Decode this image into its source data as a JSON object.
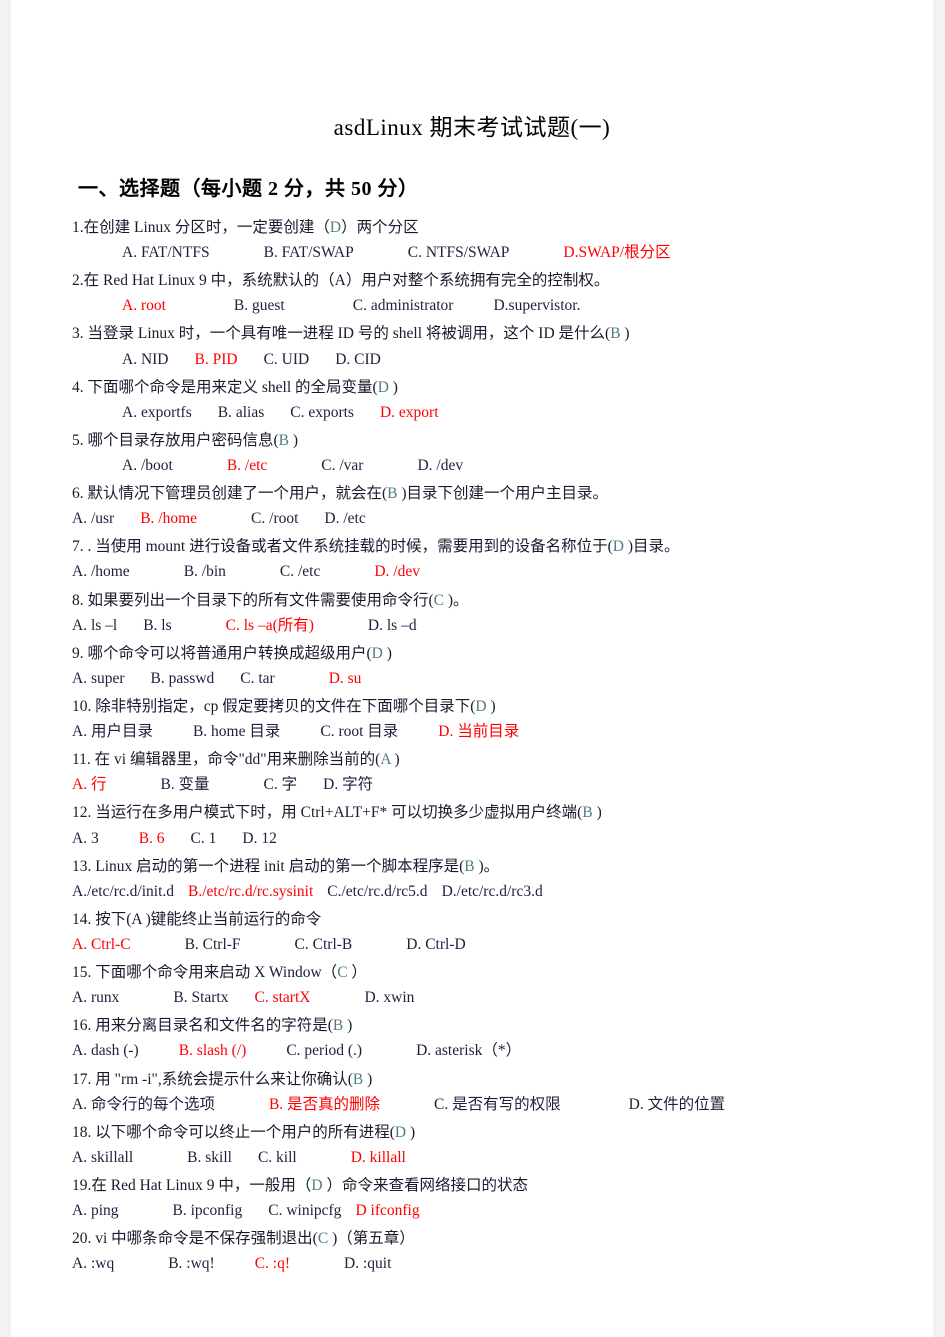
{
  "document": {
    "title": "asdLinux  期末考试试题(一)",
    "section_heading": "一、选择题（每小题 2 分，共 50 分）"
  },
  "questions": [
    {
      "stem_prefix": "1.在创建 Linux 分区时，一定要创建（",
      "answer": "D",
      "stem_suffix": "）两个分区",
      "answer_color": "teal",
      "options_indent": "indent",
      "options": [
        {
          "label": "A. FAT/NTFS",
          "correct": false,
          "gap": "sp-3"
        },
        {
          "label": "B. FAT/SWAP",
          "correct": false,
          "gap": "sp-3"
        },
        {
          "label": "C. NTFS/SWAP",
          "correct": false,
          "gap": "sp-3"
        },
        {
          "label": "D.SWAP/根分区",
          "correct": true,
          "gap": "sp-6"
        }
      ]
    },
    {
      "stem_prefix": "2.在 Red Hat Linux 9 中，系统默认的（",
      "answer": "A",
      "stem_suffix": "）用户对整个系统拥有完全的控制权。",
      "answer_color": "black",
      "options_indent": "indent",
      "options": [
        {
          "label": "A. root",
          "correct": true,
          "gap": "sp-5"
        },
        {
          "label": "B. guest",
          "correct": false,
          "gap": "sp-5"
        },
        {
          "label": "C. administrator",
          "correct": false,
          "gap": "sp-2"
        },
        {
          "label": "D.supervistor.",
          "correct": false,
          "gap": "sp-6"
        }
      ]
    },
    {
      "stem_prefix": "3. 当登录 Linux 时，一个具有唯一进程 ID 号的 shell 将被调用，这个 ID 是什么(",
      "answer": "B",
      "stem_suffix": "  )",
      "answer_color": "teal",
      "options_indent": "indent",
      "options": [
        {
          "label": "A. NID",
          "correct": false,
          "gap": "sp-1"
        },
        {
          "label": "B. PID",
          "correct": true,
          "gap": "sp-1"
        },
        {
          "label": "C. UID",
          "correct": false,
          "gap": "sp-1"
        },
        {
          "label": "D. CID",
          "correct": false,
          "gap": "sp-6"
        }
      ]
    },
    {
      "stem_prefix": "4. 下面哪个命令是用来定义 shell 的全局变量(",
      "answer": "D",
      "stem_suffix": "  )",
      "answer_color": "teal",
      "options_indent": "indent",
      "options": [
        {
          "label": "A. exportfs",
          "correct": false,
          "gap": "sp-1"
        },
        {
          "label": "B. alias",
          "correct": false,
          "gap": "sp-1"
        },
        {
          "label": "C. exports",
          "correct": false,
          "gap": "sp-1"
        },
        {
          "label": "D. export",
          "correct": true,
          "gap": "sp-6"
        }
      ]
    },
    {
      "stem_prefix": "5. 哪个目录存放用户密码信息(",
      "answer": "B",
      "stem_suffix": "  )",
      "answer_color": "teal",
      "options_indent": "indent",
      "options": [
        {
          "label": "A. /boot",
          "correct": false,
          "gap": "sp-3"
        },
        {
          "label": "B. /etc",
          "correct": true,
          "gap": "sp-3"
        },
        {
          "label": "C. /var",
          "correct": false,
          "gap": "sp-3"
        },
        {
          "label": "D. /dev",
          "correct": false,
          "gap": "sp-6"
        }
      ]
    },
    {
      "stem_prefix": "6. 默认情况下管理员创建了一个用户，就会在(",
      "answer": "B",
      "stem_suffix": "  )目录下创建一个用户主目录。",
      "answer_color": "teal",
      "options_indent": "flush",
      "options": [
        {
          "label": "A. /usr",
          "correct": false,
          "gap": "sp-1"
        },
        {
          "label": "B. /home",
          "correct": true,
          "gap": "sp-3"
        },
        {
          "label": "C. /root",
          "correct": false,
          "gap": "sp-1"
        },
        {
          "label": "D. /etc",
          "correct": false,
          "gap": "sp-6"
        }
      ]
    },
    {
      "stem_prefix": "7. . 当使用 mount 进行设备或者文件系统挂载的时候，需要用到的设备名称位于(",
      "answer": "D",
      "stem_suffix": " )目录。",
      "answer_color": "teal",
      "options_indent": "flush",
      "options": [
        {
          "label": "A. /home",
          "correct": false,
          "gap": "sp-3"
        },
        {
          "label": "B. /bin",
          "correct": false,
          "gap": "sp-3"
        },
        {
          "label": "C. /etc",
          "correct": false,
          "gap": "sp-3"
        },
        {
          "label": "D. /dev",
          "correct": true,
          "gap": "sp-6"
        }
      ]
    },
    {
      "stem_prefix": "8. 如果要列出一个目录下的所有文件需要使用命令行(",
      "answer": "C",
      "stem_suffix": "   )。",
      "answer_color": "teal",
      "options_indent": "flush",
      "options": [
        {
          "label": "A. ls –l",
          "correct": false,
          "gap": "sp-1"
        },
        {
          "label": "B. ls",
          "correct": false,
          "gap": "sp-3"
        },
        {
          "label": "C. ls –a(所有)",
          "correct": true,
          "gap": "sp-3"
        },
        {
          "label": "D. ls –d",
          "correct": false,
          "gap": "sp-6"
        }
      ]
    },
    {
      "stem_prefix": "9. 哪个命令可以将普通用户转换成超级用户(",
      "answer": "D",
      "stem_suffix": " )",
      "answer_color": "teal",
      "options_indent": "flush",
      "options": [
        {
          "label": "A. super",
          "correct": false,
          "gap": "sp-1"
        },
        {
          "label": "B. passwd",
          "correct": false,
          "gap": "sp-1"
        },
        {
          "label": "C. tar",
          "correct": false,
          "gap": "sp-3"
        },
        {
          "label": "D. su",
          "correct": true,
          "gap": "sp-6"
        }
      ]
    },
    {
      "stem_prefix": "10. 除非特别指定，cp 假定要拷贝的文件在下面哪个目录下(",
      "answer": "D",
      "stem_suffix": "   )",
      "answer_color": "teal",
      "options_indent": "flush",
      "options": [
        {
          "label": "A. 用户目录",
          "correct": false,
          "gap": "sp-2"
        },
        {
          "label": "B. home 目录",
          "correct": false,
          "gap": "sp-2"
        },
        {
          "label": "C. root 目录",
          "correct": false,
          "gap": "sp-2"
        },
        {
          "label": "D. 当前目录",
          "correct": true,
          "gap": "sp-6"
        }
      ]
    },
    {
      "stem_prefix": "11. 在 vi 编辑器里，命令\"dd\"用来删除当前的(",
      "answer": "A",
      "stem_suffix": " )",
      "answer_color": "teal",
      "options_indent": "flush",
      "options": [
        {
          "label": "A. 行",
          "correct": true,
          "gap": "sp-3"
        },
        {
          "label": "B. 变量",
          "correct": false,
          "gap": "sp-3"
        },
        {
          "label": "C. 字",
          "correct": false,
          "gap": "sp-1"
        },
        {
          "label": "D. 字符",
          "correct": false,
          "gap": "sp-6"
        }
      ]
    },
    {
      "stem_prefix": "12. 当运行在多用户模式下时，用 Ctrl+ALT+F* 可以切换多少虚拟用户终端(",
      "answer": "B",
      "stem_suffix": "  )",
      "answer_color": "teal",
      "options_indent": "flush",
      "options": [
        {
          "label": "A. 3",
          "correct": false,
          "gap": "sp-2"
        },
        {
          "label": "B. 6",
          "correct": true,
          "gap": "sp-1"
        },
        {
          "label": "C. 1",
          "correct": false,
          "gap": "sp-1"
        },
        {
          "label": "D. 12",
          "correct": false,
          "gap": "sp-6"
        }
      ]
    },
    {
      "stem_prefix": "13. Linux 启动的第一个进程 init 启动的第一个脚本程序是(",
      "answer": "B",
      "stem_suffix": "   )。",
      "answer_color": "teal",
      "options_indent": "flush",
      "options": [
        {
          "label": "A./etc/rc.d/init.d",
          "correct": false,
          "gap": "sp-4"
        },
        {
          "label": "B./etc/rc.d/rc.sysinit",
          "correct": true,
          "gap": "sp-4"
        },
        {
          "label": "C./etc/rc.d/rc5.d",
          "correct": false,
          "gap": "sp-4"
        },
        {
          "label": "D./etc/rc.d/rc3.d",
          "correct": false,
          "gap": "sp-6"
        }
      ]
    },
    {
      "stem_prefix": "14. 按下(A",
      "answer": "",
      "stem_suffix": "    )键能终止当前运行的命令",
      "answer_color": "teal",
      "options_indent": "flush",
      "options": [
        {
          "label": "A. Ctrl-C",
          "correct": true,
          "gap": "sp-3"
        },
        {
          "label": "B. Ctrl-F",
          "correct": false,
          "gap": "sp-3"
        },
        {
          "label": "C. Ctrl-B",
          "correct": false,
          "gap": "sp-3"
        },
        {
          "label": "D. Ctrl-D",
          "correct": false,
          "gap": "sp-6"
        }
      ]
    },
    {
      "stem_prefix": "15. 下面哪个命令用来启动 X Window（",
      "answer": "C",
      "stem_suffix": "   ）",
      "answer_color": "teal",
      "options_indent": "flush",
      "options": [
        {
          "label": "A. runx",
          "correct": false,
          "gap": "sp-3"
        },
        {
          "label": "B. Startx",
          "correct": false,
          "gap": "sp-1"
        },
        {
          "label": "C. startX",
          "correct": true,
          "gap": "sp-3"
        },
        {
          "label": "D. xwin",
          "correct": false,
          "gap": "sp-6"
        }
      ]
    },
    {
      "stem_prefix": "16. 用来分离目录名和文件名的字符是(",
      "answer": "B",
      "stem_suffix": "   )",
      "answer_color": "teal",
      "options_indent": "flush",
      "options": [
        {
          "label": "A. dash (-)",
          "correct": false,
          "gap": "sp-2"
        },
        {
          "label": "B. slash (/)",
          "correct": true,
          "gap": "sp-2"
        },
        {
          "label": "C. period (.)",
          "correct": false,
          "gap": "sp-3"
        },
        {
          "label": "D. asterisk（*）",
          "correct": false,
          "gap": "sp-6"
        }
      ]
    },
    {
      "stem_prefix": "17. 用 \"rm -i\",系统会提示什么来让你确认(",
      "answer": "B",
      "stem_suffix": "   )",
      "answer_color": "teal",
      "options_indent": "flush",
      "options": [
        {
          "label": "A. 命令行的每个选项",
          "correct": false,
          "gap": "sp-3"
        },
        {
          "label": "B. 是否真的删除",
          "correct": true,
          "gap": "sp-3"
        },
        {
          "label": "C. 是否有写的权限",
          "correct": false,
          "gap": "sp-5"
        },
        {
          "label": "D. 文件的位置",
          "correct": false,
          "gap": "sp-6"
        }
      ]
    },
    {
      "stem_prefix": "18. 以下哪个命令可以终止一个用户的所有进程(",
      "answer": "D",
      "stem_suffix": "   )",
      "answer_color": "teal",
      "options_indent": "flush",
      "options": [
        {
          "label": "A. skillall",
          "correct": false,
          "gap": "sp-3"
        },
        {
          "label": "B. skill",
          "correct": false,
          "gap": "sp-1"
        },
        {
          "label": "C. kill",
          "correct": false,
          "gap": "sp-3"
        },
        {
          "label": "D. killall",
          "correct": true,
          "gap": "sp-6"
        }
      ]
    },
    {
      "stem_prefix": "19.在 Red Hat Linux 9 中，一般用（",
      "answer": "D",
      "stem_suffix": "   ）命令来查看网络接口的状态",
      "answer_color": "teal",
      "options_indent": "flush",
      "options": [
        {
          "label": "A. ping",
          "correct": false,
          "gap": "sp-3"
        },
        {
          "label": "B. ipconfig",
          "correct": false,
          "gap": "sp-1"
        },
        {
          "label": "C. winipcfg",
          "correct": false,
          "gap": "sp-4"
        },
        {
          "label": "D   ifconfig",
          "correct": true,
          "gap": "sp-6"
        }
      ]
    },
    {
      "stem_prefix": "20. vi 中哪条命令是不保存强制退出(",
      "answer": "C",
      "stem_suffix": "   )（第五章）",
      "answer_color": "teal",
      "options_indent": "flush",
      "options": [
        {
          "label": "A. :wq",
          "correct": false,
          "gap": "sp-3"
        },
        {
          "label": "B. :wq!",
          "correct": false,
          "gap": "sp-2"
        },
        {
          "label": "C. :q!",
          "correct": true,
          "gap": "sp-3"
        },
        {
          "label": "D. :quit",
          "correct": false,
          "gap": "sp-6"
        }
      ]
    }
  ],
  "colors": {
    "correct_option": "#ff0000",
    "answer_marker": "#4f7d82",
    "body_text": "#1a1a2e",
    "page_background": "#f2f2f2",
    "sheet_background": "#ffffff"
  }
}
